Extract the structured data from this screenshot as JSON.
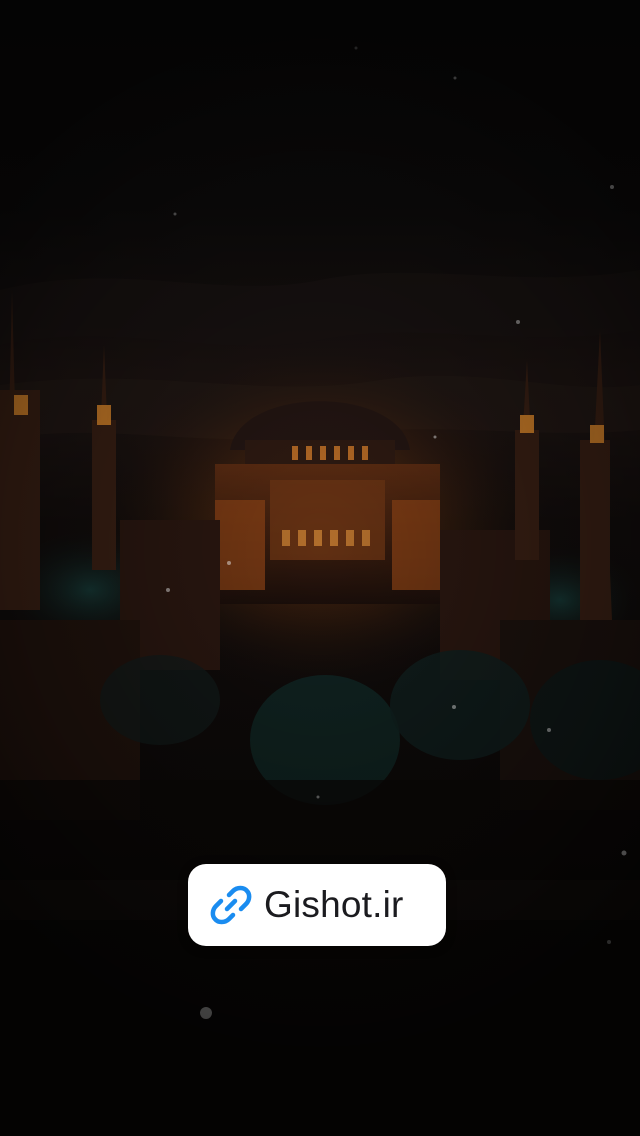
{
  "watermark": {
    "label": "Gishot.ir",
    "icon": "link-icon",
    "icon_color": "#1a8cf0",
    "background": "#ffffff"
  },
  "background": {
    "subject": "night-mosque-photo",
    "colors": {
      "sky": "#0e0c0c",
      "glow": "#b85a1a",
      "teal": "#1f6f6a"
    }
  }
}
